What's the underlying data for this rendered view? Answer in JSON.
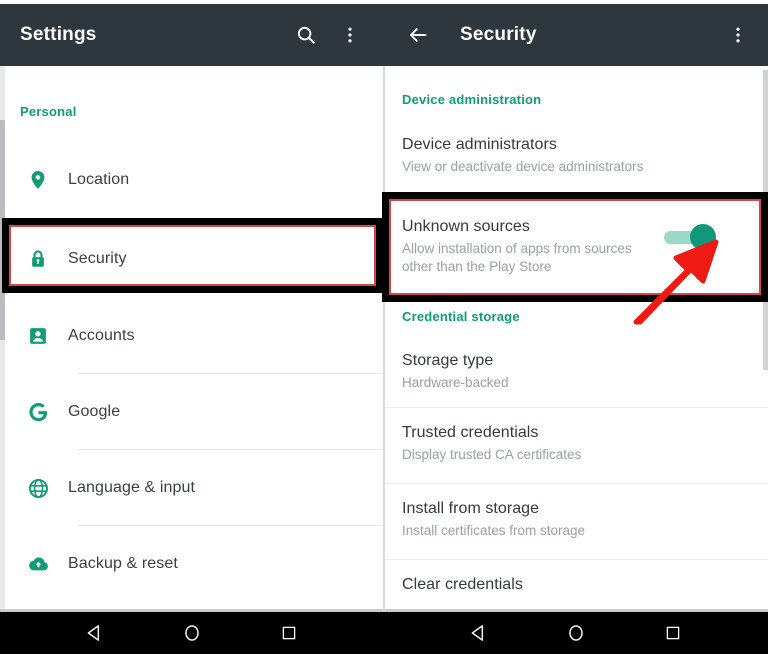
{
  "left_panel": {
    "appbar": {
      "title": "Settings",
      "search_icon": "search-icon",
      "overflow_icon": "more-vert-icon"
    },
    "section_header": "Personal",
    "items": [
      {
        "label": "Location",
        "icon": "location-pin-icon"
      },
      {
        "label": "Security",
        "icon": "lock-icon"
      },
      {
        "label": "Accounts",
        "icon": "account-box-icon"
      },
      {
        "label": "Google",
        "icon": "google-g-icon"
      },
      {
        "label": "Language & input",
        "icon": "globe-icon"
      },
      {
        "label": "Backup & reset",
        "icon": "cloud-upload-icon"
      }
    ]
  },
  "right_panel": {
    "appbar": {
      "title": "Security",
      "back_icon": "arrow-back-icon",
      "overflow_icon": "more-vert-icon"
    },
    "sections": [
      {
        "header": "Device administration",
        "items": [
          {
            "title": "Device administrators",
            "subtitle": "View or deactivate device administrators"
          },
          {
            "title": "Unknown sources",
            "subtitle": "Allow installation of apps from sources other than the Play Store",
            "toggle": "on"
          }
        ]
      },
      {
        "header": "Credential storage",
        "items": [
          {
            "title": "Storage type",
            "subtitle": "Hardware-backed"
          },
          {
            "title": "Trusted credentials",
            "subtitle": "Display trusted CA certificates"
          },
          {
            "title": "Install from storage",
            "subtitle": "Install certificates from storage"
          },
          {
            "title": "Clear credentials",
            "subtitle": ""
          }
        ]
      }
    ]
  },
  "navbar": {
    "buttons": [
      {
        "name": "back-nav-button",
        "icon": "triangle-back-icon"
      },
      {
        "name": "home-nav-button",
        "icon": "circle-home-icon"
      },
      {
        "name": "recents-nav-button",
        "icon": "square-recents-icon"
      }
    ]
  },
  "annotations": {
    "highlight_security": "Security",
    "highlight_unknown_sources": "Unknown sources",
    "arrow": "red-arrow-pointing-to-toggle"
  },
  "colors": {
    "appbar": "#2e363e",
    "accent_teal": "#0f9d76",
    "toggle_on": "#11977a",
    "toggle_track": "#9bd9c8",
    "highlight_black": "#000000",
    "highlight_red": "#d2474b",
    "navbar": "#000000"
  }
}
